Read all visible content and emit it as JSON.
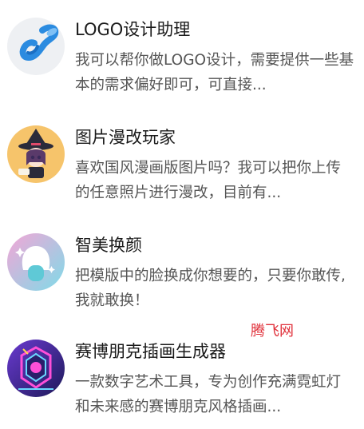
{
  "items": [
    {
      "title": "LOGO设计助理",
      "description": "我可以帮你做LOGO设计，需要提供一些基本的需求偏好即可，可直接...",
      "icon": "logo-assistant-icon",
      "avatar_bg": "#eef0f3"
    },
    {
      "title": "图片漫改玩家",
      "description": "喜欢国风漫画版图片吗？我可以把你上传的任意照片进行漫改，目前有...",
      "icon": "anime-witch-icon",
      "avatar_bg": "#f6c46b"
    },
    {
      "title": "智美换颜",
      "description": "把模版中的脸换成你想要的，只要你敢传,我就敢换！",
      "icon": "face-swap-icon",
      "avatar_bg": "#8fd6e8"
    },
    {
      "title": "赛博朋克插画生成器",
      "description": "一款数字艺术工具，专为创作充满霓虹灯和未来感的赛博朋克风格插画...",
      "icon": "cyberpunk-art-icon",
      "avatar_bg": "#3a2a8a"
    }
  ],
  "watermark": "腾飞网"
}
